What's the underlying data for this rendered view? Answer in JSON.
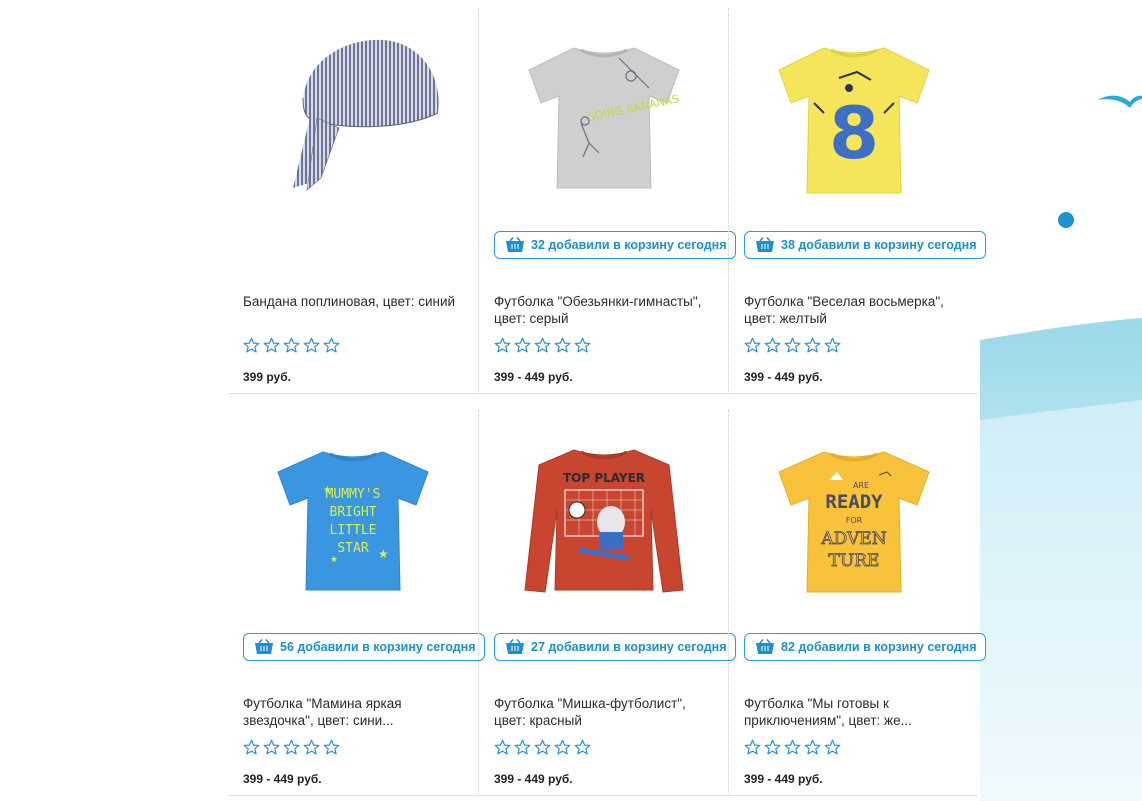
{
  "products": [
    {
      "title": "Бандана поплиновая, цвет: синий",
      "price": "399 руб.",
      "cart_text": "",
      "image": "bandana-image",
      "rating": 0
    },
    {
      "title": "Футболка \"Обезьянки-гимнасты\", цвет: серый",
      "price": "399  - 449 руб.",
      "cart_text": "32 добавили в корзину сегодня",
      "image": "grey-monkey-tshirt-image",
      "rating": 0
    },
    {
      "title": "Футболка \"Веселая восьмерка\", цвет: желтый",
      "price": "399  - 449 руб.",
      "cart_text": "38 добавили в корзину сегодня",
      "image": "yellow-eight-tshirt-image",
      "rating": 0
    },
    {
      "title": "Футболка \"Мамина яркая звездочка\", цвет: сини...",
      "price": "399  - 449 руб.",
      "cart_text": "56 добавили в корзину сегодня",
      "image": "blue-star-tshirt-image",
      "rating": 0
    },
    {
      "title": "Футболка \"Мишка-футболист\", цвет: красный",
      "price": "399  - 449 руб.",
      "cart_text": "27 добавили в корзину сегодня",
      "image": "red-football-longsleeve-image",
      "rating": 0
    },
    {
      "title": "Футболка \"Мы готовы к приключениям\", цвет: же...",
      "price": "399  - 449 руб.",
      "cart_text": "82 добавили в корзину сегодня",
      "image": "yellow-adventure-tshirt-image",
      "rating": 0
    }
  ],
  "prints": {
    "blue_tshirt": [
      "MUMMY'S",
      "BRIGHT",
      "LITTLE",
      "STAR"
    ],
    "red_shirt_top": "TOP PLAYER",
    "yellow_tshirt": [
      "ARE",
      "READY",
      "FOR",
      "ADVEN",
      "TURE"
    ],
    "eight_digit": "8"
  },
  "colors": {
    "accent": "#1e8fcf",
    "star_outline": "#2a8fd6",
    "grey_shirt": "#cfcfcf",
    "yellow_shirt": "#f4e55a",
    "blue_shirt": "#3a96e0",
    "red_shirt": "#c8452f",
    "orange_shirt": "#f8c33a"
  }
}
